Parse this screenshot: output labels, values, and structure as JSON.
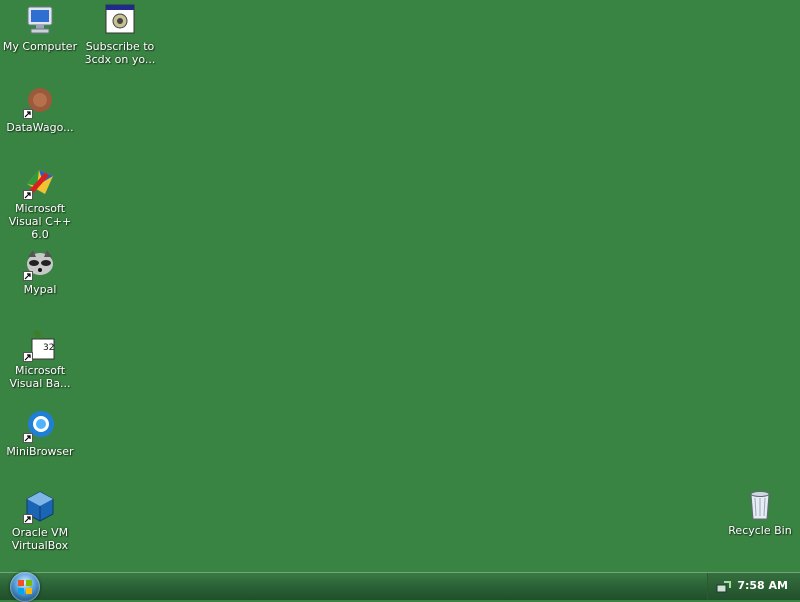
{
  "desktop": {
    "icons": [
      {
        "label": "My Computer"
      },
      {
        "label": "Subscribe to 3cdx on yo..."
      },
      {
        "label": "DataWago..."
      },
      {
        "label": "Microsoft Visual C++ 6.0"
      },
      {
        "label": "Mypal"
      },
      {
        "label": "Microsoft Visual Ba..."
      },
      {
        "label": "MiniBrowser"
      },
      {
        "label": "Oracle VM VirtualBox"
      },
      {
        "label": "Recycle Bin"
      }
    ]
  },
  "taskbar": {
    "clock": "7:58 AM"
  },
  "colors": {
    "desktop_background": "#3a8443",
    "taskbar": "#2c6437"
  }
}
